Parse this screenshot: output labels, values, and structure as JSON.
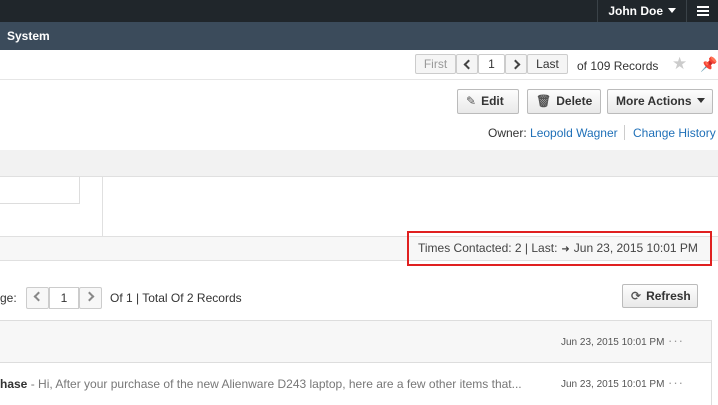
{
  "header": {
    "user_name": "John Doe",
    "menu_icon": "hamburger-icon"
  },
  "nav": {
    "item": "System"
  },
  "pager": {
    "first": "First",
    "page": "1",
    "last": "Last",
    "records": "of 109 Records"
  },
  "toolbar": {
    "edit": "Edit",
    "delete": "Delete",
    "more_actions": "More Actions"
  },
  "owner": {
    "label": "Owner:",
    "name": "Leopold Wagner",
    "change_history": "Change History"
  },
  "contact": {
    "times_label": "Times Contacted: 2 | Last:",
    "last_date": "Jun 23, 2015 10:01 PM"
  },
  "list_pager": {
    "label": "ge:",
    "page": "1",
    "summary": "Of 1 | Total Of 2 Records",
    "refresh": "Refresh"
  },
  "activities": [
    {
      "subject": "",
      "preview": "",
      "time": "Jun 23, 2015 10:01 PM"
    },
    {
      "subject": "hase",
      "preview": " - Hi, After your purchase of the new Alienware D243 laptop, here are a few other items that...",
      "time": "Jun 23, 2015 10:01 PM"
    }
  ],
  "colors": {
    "topbar": "#20262b",
    "navbar": "#3b4b5b",
    "link": "#1f70b8",
    "highlight": "#e02020"
  }
}
